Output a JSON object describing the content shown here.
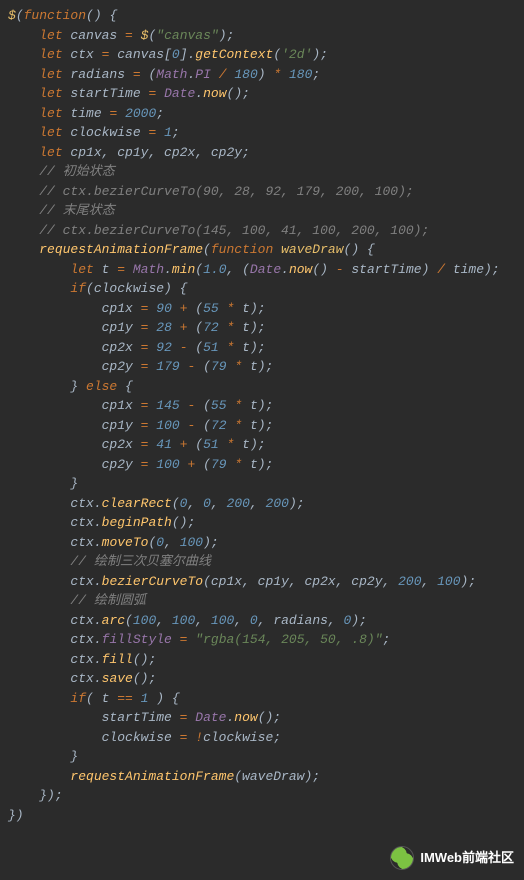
{
  "watermark": {
    "label": "IMWeb前端社区"
  },
  "code_lines": [
    {
      "indent": 0,
      "tokens": [
        {
          "t": "$",
          "c": "dollar"
        },
        {
          "t": "(",
          "c": "p"
        },
        {
          "t": "function",
          "c": "kw"
        },
        {
          "t": "() {",
          "c": "p"
        }
      ]
    },
    {
      "indent": 1,
      "tokens": [
        {
          "t": "let",
          "c": "kw"
        },
        {
          "t": " canvas ",
          "c": "id"
        },
        {
          "t": "=",
          "c": "op"
        },
        {
          "t": " ",
          "c": "p"
        },
        {
          "t": "$",
          "c": "dollar"
        },
        {
          "t": "(",
          "c": "p"
        },
        {
          "t": "\"canvas\"",
          "c": "str"
        },
        {
          "t": ");",
          "c": "p"
        }
      ]
    },
    {
      "indent": 1,
      "tokens": [
        {
          "t": "let",
          "c": "kw"
        },
        {
          "t": " ctx ",
          "c": "id"
        },
        {
          "t": "=",
          "c": "op"
        },
        {
          "t": " canvas[",
          "c": "id"
        },
        {
          "t": "0",
          "c": "num"
        },
        {
          "t": "].",
          "c": "p"
        },
        {
          "t": "getContext",
          "c": "call"
        },
        {
          "t": "(",
          "c": "p"
        },
        {
          "t": "'2d'",
          "c": "str"
        },
        {
          "t": ");",
          "c": "p"
        }
      ]
    },
    {
      "indent": 1,
      "tokens": [
        {
          "t": "let",
          "c": "kw"
        },
        {
          "t": " radians ",
          "c": "id"
        },
        {
          "t": "=",
          "c": "op"
        },
        {
          "t": " (",
          "c": "p"
        },
        {
          "t": "Math",
          "c": "var"
        },
        {
          "t": ".",
          "c": "p"
        },
        {
          "t": "PI",
          "c": "var"
        },
        {
          "t": " ",
          "c": "p"
        },
        {
          "t": "/",
          "c": "op"
        },
        {
          "t": " ",
          "c": "p"
        },
        {
          "t": "180",
          "c": "num"
        },
        {
          "t": ") ",
          "c": "p"
        },
        {
          "t": "*",
          "c": "op"
        },
        {
          "t": " ",
          "c": "p"
        },
        {
          "t": "180",
          "c": "num"
        },
        {
          "t": ";",
          "c": "p"
        }
      ]
    },
    {
      "indent": 1,
      "tokens": [
        {
          "t": "let",
          "c": "kw"
        },
        {
          "t": " startTime ",
          "c": "id"
        },
        {
          "t": "=",
          "c": "op"
        },
        {
          "t": " ",
          "c": "p"
        },
        {
          "t": "Date",
          "c": "var"
        },
        {
          "t": ".",
          "c": "p"
        },
        {
          "t": "now",
          "c": "call"
        },
        {
          "t": "();",
          "c": "p"
        }
      ]
    },
    {
      "indent": 1,
      "tokens": [
        {
          "t": "let",
          "c": "kw"
        },
        {
          "t": " time ",
          "c": "id"
        },
        {
          "t": "=",
          "c": "op"
        },
        {
          "t": " ",
          "c": "p"
        },
        {
          "t": "2000",
          "c": "num"
        },
        {
          "t": ";",
          "c": "p"
        }
      ]
    },
    {
      "indent": 1,
      "tokens": [
        {
          "t": "let",
          "c": "kw"
        },
        {
          "t": " clockwise ",
          "c": "id"
        },
        {
          "t": "=",
          "c": "op"
        },
        {
          "t": " ",
          "c": "p"
        },
        {
          "t": "1",
          "c": "num"
        },
        {
          "t": ";",
          "c": "p"
        }
      ]
    },
    {
      "indent": 1,
      "tokens": [
        {
          "t": "let",
          "c": "kw"
        },
        {
          "t": " cp1x, cp1y, cp2x, cp2y;",
          "c": "id"
        }
      ]
    },
    {
      "indent": 0,
      "tokens": [
        {
          "t": "",
          "c": "p"
        }
      ]
    },
    {
      "indent": 1,
      "tokens": [
        {
          "t": "// 初始状态",
          "c": "cmt"
        }
      ]
    },
    {
      "indent": 1,
      "tokens": [
        {
          "t": "// ctx.bezierCurveTo(90, 28, 92, 179, 200, 100);",
          "c": "cmt"
        }
      ]
    },
    {
      "indent": 1,
      "tokens": [
        {
          "t": "// 末尾状态",
          "c": "cmt"
        }
      ]
    },
    {
      "indent": 1,
      "tokens": [
        {
          "t": "// ctx.bezierCurveTo(145, 100, 41, 100, 200, 100);",
          "c": "cmt"
        }
      ]
    },
    {
      "indent": 0,
      "tokens": [
        {
          "t": "",
          "c": "p"
        }
      ]
    },
    {
      "indent": 1,
      "tokens": [
        {
          "t": "requestAnimationFrame",
          "c": "call"
        },
        {
          "t": "(",
          "c": "p"
        },
        {
          "t": "function",
          "c": "kw"
        },
        {
          "t": " ",
          "c": "p"
        },
        {
          "t": "waveDraw",
          "c": "fn"
        },
        {
          "t": "() {",
          "c": "p"
        }
      ]
    },
    {
      "indent": 2,
      "tokens": [
        {
          "t": "let",
          "c": "kw"
        },
        {
          "t": " t ",
          "c": "id"
        },
        {
          "t": "=",
          "c": "op"
        },
        {
          "t": " ",
          "c": "p"
        },
        {
          "t": "Math",
          "c": "var"
        },
        {
          "t": ".",
          "c": "p"
        },
        {
          "t": "min",
          "c": "call"
        },
        {
          "t": "(",
          "c": "p"
        },
        {
          "t": "1.0",
          "c": "num"
        },
        {
          "t": ", (",
          "c": "p"
        },
        {
          "t": "Date",
          "c": "var"
        },
        {
          "t": ".",
          "c": "p"
        },
        {
          "t": "now",
          "c": "call"
        },
        {
          "t": "() ",
          "c": "p"
        },
        {
          "t": "-",
          "c": "op"
        },
        {
          "t": " startTime) ",
          "c": "id"
        },
        {
          "t": "/",
          "c": "op"
        },
        {
          "t": " time);",
          "c": "id"
        }
      ]
    },
    {
      "indent": 0,
      "tokens": [
        {
          "t": "",
          "c": "p"
        }
      ]
    },
    {
      "indent": 2,
      "tokens": [
        {
          "t": "if",
          "c": "kw"
        },
        {
          "t": "(clockwise) {",
          "c": "id"
        }
      ]
    },
    {
      "indent": 3,
      "tokens": [
        {
          "t": "cp1x ",
          "c": "id"
        },
        {
          "t": "=",
          "c": "op"
        },
        {
          "t": " ",
          "c": "p"
        },
        {
          "t": "90",
          "c": "num"
        },
        {
          "t": " ",
          "c": "p"
        },
        {
          "t": "+",
          "c": "op"
        },
        {
          "t": " (",
          "c": "p"
        },
        {
          "t": "55",
          "c": "num"
        },
        {
          "t": " ",
          "c": "p"
        },
        {
          "t": "*",
          "c": "op"
        },
        {
          "t": " t);",
          "c": "id"
        }
      ]
    },
    {
      "indent": 3,
      "tokens": [
        {
          "t": "cp1y ",
          "c": "id"
        },
        {
          "t": "=",
          "c": "op"
        },
        {
          "t": " ",
          "c": "p"
        },
        {
          "t": "28",
          "c": "num"
        },
        {
          "t": " ",
          "c": "p"
        },
        {
          "t": "+",
          "c": "op"
        },
        {
          "t": " (",
          "c": "p"
        },
        {
          "t": "72",
          "c": "num"
        },
        {
          "t": " ",
          "c": "p"
        },
        {
          "t": "*",
          "c": "op"
        },
        {
          "t": " t);",
          "c": "id"
        }
      ]
    },
    {
      "indent": 3,
      "tokens": [
        {
          "t": "cp2x ",
          "c": "id"
        },
        {
          "t": "=",
          "c": "op"
        },
        {
          "t": " ",
          "c": "p"
        },
        {
          "t": "92",
          "c": "num"
        },
        {
          "t": " ",
          "c": "p"
        },
        {
          "t": "-",
          "c": "op"
        },
        {
          "t": " (",
          "c": "p"
        },
        {
          "t": "51",
          "c": "num"
        },
        {
          "t": " ",
          "c": "p"
        },
        {
          "t": "*",
          "c": "op"
        },
        {
          "t": " t);",
          "c": "id"
        }
      ]
    },
    {
      "indent": 3,
      "tokens": [
        {
          "t": "cp2y ",
          "c": "id"
        },
        {
          "t": "=",
          "c": "op"
        },
        {
          "t": " ",
          "c": "p"
        },
        {
          "t": "179",
          "c": "num"
        },
        {
          "t": " ",
          "c": "p"
        },
        {
          "t": "-",
          "c": "op"
        },
        {
          "t": " (",
          "c": "p"
        },
        {
          "t": "79",
          "c": "num"
        },
        {
          "t": " ",
          "c": "p"
        },
        {
          "t": "*",
          "c": "op"
        },
        {
          "t": " t);",
          "c": "id"
        }
      ]
    },
    {
      "indent": 2,
      "tokens": [
        {
          "t": "} ",
          "c": "p"
        },
        {
          "t": "else",
          "c": "kw"
        },
        {
          "t": " {",
          "c": "p"
        }
      ]
    },
    {
      "indent": 3,
      "tokens": [
        {
          "t": "cp1x ",
          "c": "id"
        },
        {
          "t": "=",
          "c": "op"
        },
        {
          "t": " ",
          "c": "p"
        },
        {
          "t": "145",
          "c": "num"
        },
        {
          "t": " ",
          "c": "p"
        },
        {
          "t": "-",
          "c": "op"
        },
        {
          "t": " (",
          "c": "p"
        },
        {
          "t": "55",
          "c": "num"
        },
        {
          "t": " ",
          "c": "p"
        },
        {
          "t": "*",
          "c": "op"
        },
        {
          "t": " t);",
          "c": "id"
        }
      ]
    },
    {
      "indent": 3,
      "tokens": [
        {
          "t": "cp1y ",
          "c": "id"
        },
        {
          "t": "=",
          "c": "op"
        },
        {
          "t": " ",
          "c": "p"
        },
        {
          "t": "100",
          "c": "num"
        },
        {
          "t": " ",
          "c": "p"
        },
        {
          "t": "-",
          "c": "op"
        },
        {
          "t": " (",
          "c": "p"
        },
        {
          "t": "72",
          "c": "num"
        },
        {
          "t": " ",
          "c": "p"
        },
        {
          "t": "*",
          "c": "op"
        },
        {
          "t": " t);",
          "c": "id"
        }
      ]
    },
    {
      "indent": 3,
      "tokens": [
        {
          "t": "cp2x ",
          "c": "id"
        },
        {
          "t": "=",
          "c": "op"
        },
        {
          "t": " ",
          "c": "p"
        },
        {
          "t": "41",
          "c": "num"
        },
        {
          "t": " ",
          "c": "p"
        },
        {
          "t": "+",
          "c": "op"
        },
        {
          "t": " (",
          "c": "p"
        },
        {
          "t": "51",
          "c": "num"
        },
        {
          "t": " ",
          "c": "p"
        },
        {
          "t": "*",
          "c": "op"
        },
        {
          "t": " t);",
          "c": "id"
        }
      ]
    },
    {
      "indent": 3,
      "tokens": [
        {
          "t": "cp2y ",
          "c": "id"
        },
        {
          "t": "=",
          "c": "op"
        },
        {
          "t": " ",
          "c": "p"
        },
        {
          "t": "100",
          "c": "num"
        },
        {
          "t": " ",
          "c": "p"
        },
        {
          "t": "+",
          "c": "op"
        },
        {
          "t": " (",
          "c": "p"
        },
        {
          "t": "79",
          "c": "num"
        },
        {
          "t": " ",
          "c": "p"
        },
        {
          "t": "*",
          "c": "op"
        },
        {
          "t": " t);",
          "c": "id"
        }
      ]
    },
    {
      "indent": 2,
      "tokens": [
        {
          "t": "}",
          "c": "p"
        }
      ]
    },
    {
      "indent": 0,
      "tokens": [
        {
          "t": "",
          "c": "p"
        }
      ]
    },
    {
      "indent": 2,
      "tokens": [
        {
          "t": "ctx.",
          "c": "id"
        },
        {
          "t": "clearRect",
          "c": "call"
        },
        {
          "t": "(",
          "c": "p"
        },
        {
          "t": "0",
          "c": "num"
        },
        {
          "t": ", ",
          "c": "p"
        },
        {
          "t": "0",
          "c": "num"
        },
        {
          "t": ", ",
          "c": "p"
        },
        {
          "t": "200",
          "c": "num"
        },
        {
          "t": ", ",
          "c": "p"
        },
        {
          "t": "200",
          "c": "num"
        },
        {
          "t": ");",
          "c": "p"
        }
      ]
    },
    {
      "indent": 2,
      "tokens": [
        {
          "t": "ctx.",
          "c": "id"
        },
        {
          "t": "beginPath",
          "c": "call"
        },
        {
          "t": "();",
          "c": "p"
        }
      ]
    },
    {
      "indent": 2,
      "tokens": [
        {
          "t": "ctx.",
          "c": "id"
        },
        {
          "t": "moveTo",
          "c": "call"
        },
        {
          "t": "(",
          "c": "p"
        },
        {
          "t": "0",
          "c": "num"
        },
        {
          "t": ", ",
          "c": "p"
        },
        {
          "t": "100",
          "c": "num"
        },
        {
          "t": ");",
          "c": "p"
        }
      ]
    },
    {
      "indent": 2,
      "tokens": [
        {
          "t": "// 绘制三次贝塞尔曲线",
          "c": "cmt"
        }
      ]
    },
    {
      "indent": 2,
      "tokens": [
        {
          "t": "ctx.",
          "c": "id"
        },
        {
          "t": "bezierCurveTo",
          "c": "call"
        },
        {
          "t": "(cp1x, cp1y, cp2x, cp2y, ",
          "c": "id"
        },
        {
          "t": "200",
          "c": "num"
        },
        {
          "t": ", ",
          "c": "p"
        },
        {
          "t": "100",
          "c": "num"
        },
        {
          "t": ");",
          "c": "p"
        }
      ]
    },
    {
      "indent": 2,
      "tokens": [
        {
          "t": "// 绘制圆弧",
          "c": "cmt"
        }
      ]
    },
    {
      "indent": 2,
      "tokens": [
        {
          "t": "ctx.",
          "c": "id"
        },
        {
          "t": "arc",
          "c": "call"
        },
        {
          "t": "(",
          "c": "p"
        },
        {
          "t": "100",
          "c": "num"
        },
        {
          "t": ", ",
          "c": "p"
        },
        {
          "t": "100",
          "c": "num"
        },
        {
          "t": ", ",
          "c": "p"
        },
        {
          "t": "100",
          "c": "num"
        },
        {
          "t": ", ",
          "c": "p"
        },
        {
          "t": "0",
          "c": "num"
        },
        {
          "t": ", radians, ",
          "c": "id"
        },
        {
          "t": "0",
          "c": "num"
        },
        {
          "t": ");",
          "c": "p"
        }
      ]
    },
    {
      "indent": 2,
      "tokens": [
        {
          "t": "ctx.",
          "c": "id"
        },
        {
          "t": "fillStyle",
          "c": "var"
        },
        {
          "t": " ",
          "c": "p"
        },
        {
          "t": "=",
          "c": "op"
        },
        {
          "t": " ",
          "c": "p"
        },
        {
          "t": "\"rgba(154, 205, 50, .8)\"",
          "c": "str"
        },
        {
          "t": ";",
          "c": "p"
        }
      ]
    },
    {
      "indent": 2,
      "tokens": [
        {
          "t": "ctx.",
          "c": "id"
        },
        {
          "t": "fill",
          "c": "call"
        },
        {
          "t": "();",
          "c": "p"
        }
      ]
    },
    {
      "indent": 2,
      "tokens": [
        {
          "t": "ctx.",
          "c": "id"
        },
        {
          "t": "save",
          "c": "call"
        },
        {
          "t": "();",
          "c": "p"
        }
      ]
    },
    {
      "indent": 0,
      "tokens": [
        {
          "t": "",
          "c": "p"
        }
      ]
    },
    {
      "indent": 2,
      "tokens": [
        {
          "t": "if",
          "c": "kw"
        },
        {
          "t": "( t ",
          "c": "id"
        },
        {
          "t": "==",
          "c": "op"
        },
        {
          "t": " ",
          "c": "p"
        },
        {
          "t": "1",
          "c": "num"
        },
        {
          "t": " ) {",
          "c": "p"
        }
      ]
    },
    {
      "indent": 3,
      "tokens": [
        {
          "t": "startTime ",
          "c": "id"
        },
        {
          "t": "=",
          "c": "op"
        },
        {
          "t": " ",
          "c": "p"
        },
        {
          "t": "Date",
          "c": "var"
        },
        {
          "t": ".",
          "c": "p"
        },
        {
          "t": "now",
          "c": "call"
        },
        {
          "t": "();",
          "c": "p"
        }
      ]
    },
    {
      "indent": 3,
      "tokens": [
        {
          "t": "clockwise ",
          "c": "id"
        },
        {
          "t": "=",
          "c": "op"
        },
        {
          "t": " ",
          "c": "p"
        },
        {
          "t": "!",
          "c": "op"
        },
        {
          "t": "clockwise;",
          "c": "id"
        }
      ]
    },
    {
      "indent": 2,
      "tokens": [
        {
          "t": "}",
          "c": "p"
        }
      ]
    },
    {
      "indent": 0,
      "tokens": [
        {
          "t": "",
          "c": "p"
        }
      ]
    },
    {
      "indent": 2,
      "tokens": [
        {
          "t": "requestAnimationFrame",
          "c": "call"
        },
        {
          "t": "(waveDraw);",
          "c": "id"
        }
      ]
    },
    {
      "indent": 1,
      "tokens": [
        {
          "t": "});",
          "c": "p"
        }
      ]
    },
    {
      "indent": 0,
      "tokens": [
        {
          "t": "})",
          "c": "p"
        }
      ]
    }
  ]
}
